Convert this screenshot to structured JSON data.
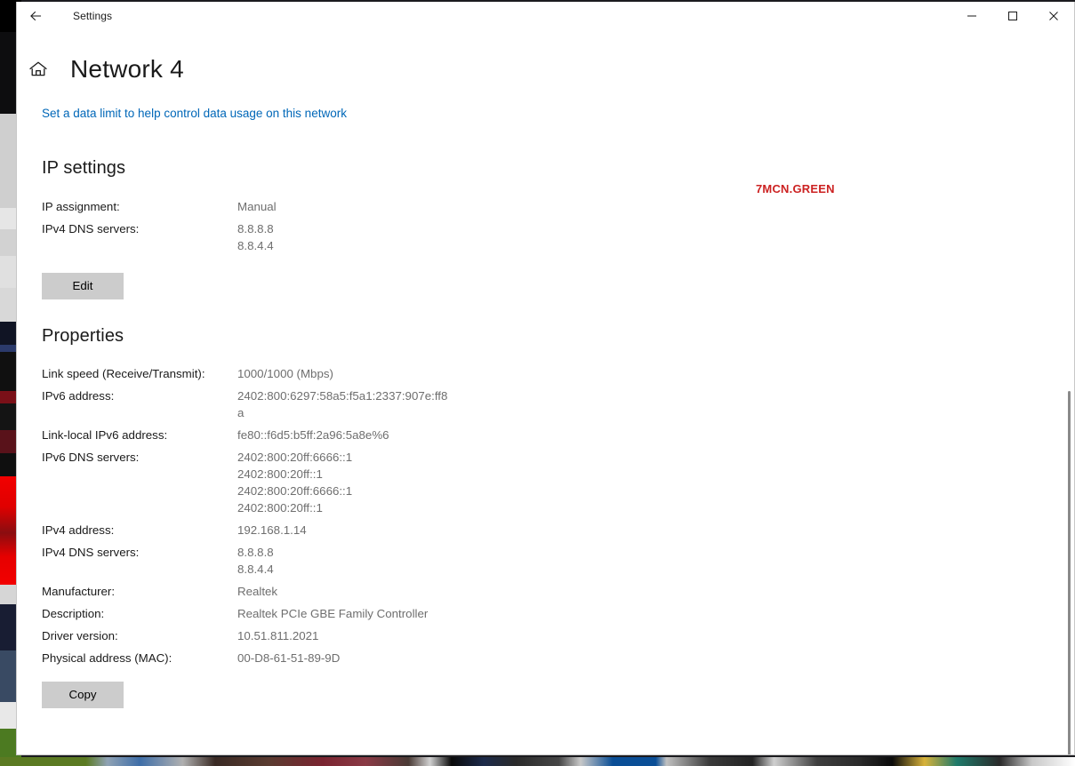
{
  "window": {
    "titlebar": {
      "back_icon": "back-arrow-icon",
      "title": "Settings",
      "minimize_label": "—",
      "maximize_label": "□",
      "close_label": "✕"
    }
  },
  "page": {
    "home_icon": "home-icon",
    "title": "Network 4",
    "data_limit_link": "Set a data limit to help control data usage on this network"
  },
  "watermark": {
    "text": "7MCN.GREEN",
    "color": "#cc2222"
  },
  "ip_settings": {
    "heading": "IP settings",
    "rows": [
      {
        "label": "IP assignment:",
        "value": "Manual"
      },
      {
        "label": "IPv4 DNS servers:",
        "value": "8.8.8.8\n8.8.4.4"
      }
    ],
    "edit_button": "Edit"
  },
  "properties": {
    "heading": "Properties",
    "rows": [
      {
        "label": "Link speed (Receive/Transmit):",
        "value": "1000/1000 (Mbps)"
      },
      {
        "label": "IPv6 address:",
        "value": "2402:800:6297:58a5:f5a1:2337:907e:ff8\na"
      },
      {
        "label": "Link-local IPv6 address:",
        "value": "fe80::f6d5:b5ff:2a96:5a8e%6"
      },
      {
        "label": "IPv6 DNS servers:",
        "value": "2402:800:20ff:6666::1\n2402:800:20ff::1\n2402:800:20ff:6666::1\n2402:800:20ff::1"
      },
      {
        "label": "IPv4 address:",
        "value": "192.168.1.14"
      },
      {
        "label": "IPv4 DNS servers:",
        "value": "8.8.8.8\n8.8.4.4"
      },
      {
        "label": "Manufacturer:",
        "value": "Realtek"
      },
      {
        "label": "Description:",
        "value": "Realtek PCIe GBE Family Controller"
      },
      {
        "label": "Driver version:",
        "value": "10.51.811.2021"
      },
      {
        "label": "Physical address (MAC):",
        "value": "00-D8-61-51-89-9D"
      }
    ],
    "copy_button": "Copy"
  },
  "theme": {
    "link_color": "#0067b8",
    "label_color": "#1a1a1a",
    "value_color": "#6e6e6e",
    "button_bg": "#cccccc"
  }
}
